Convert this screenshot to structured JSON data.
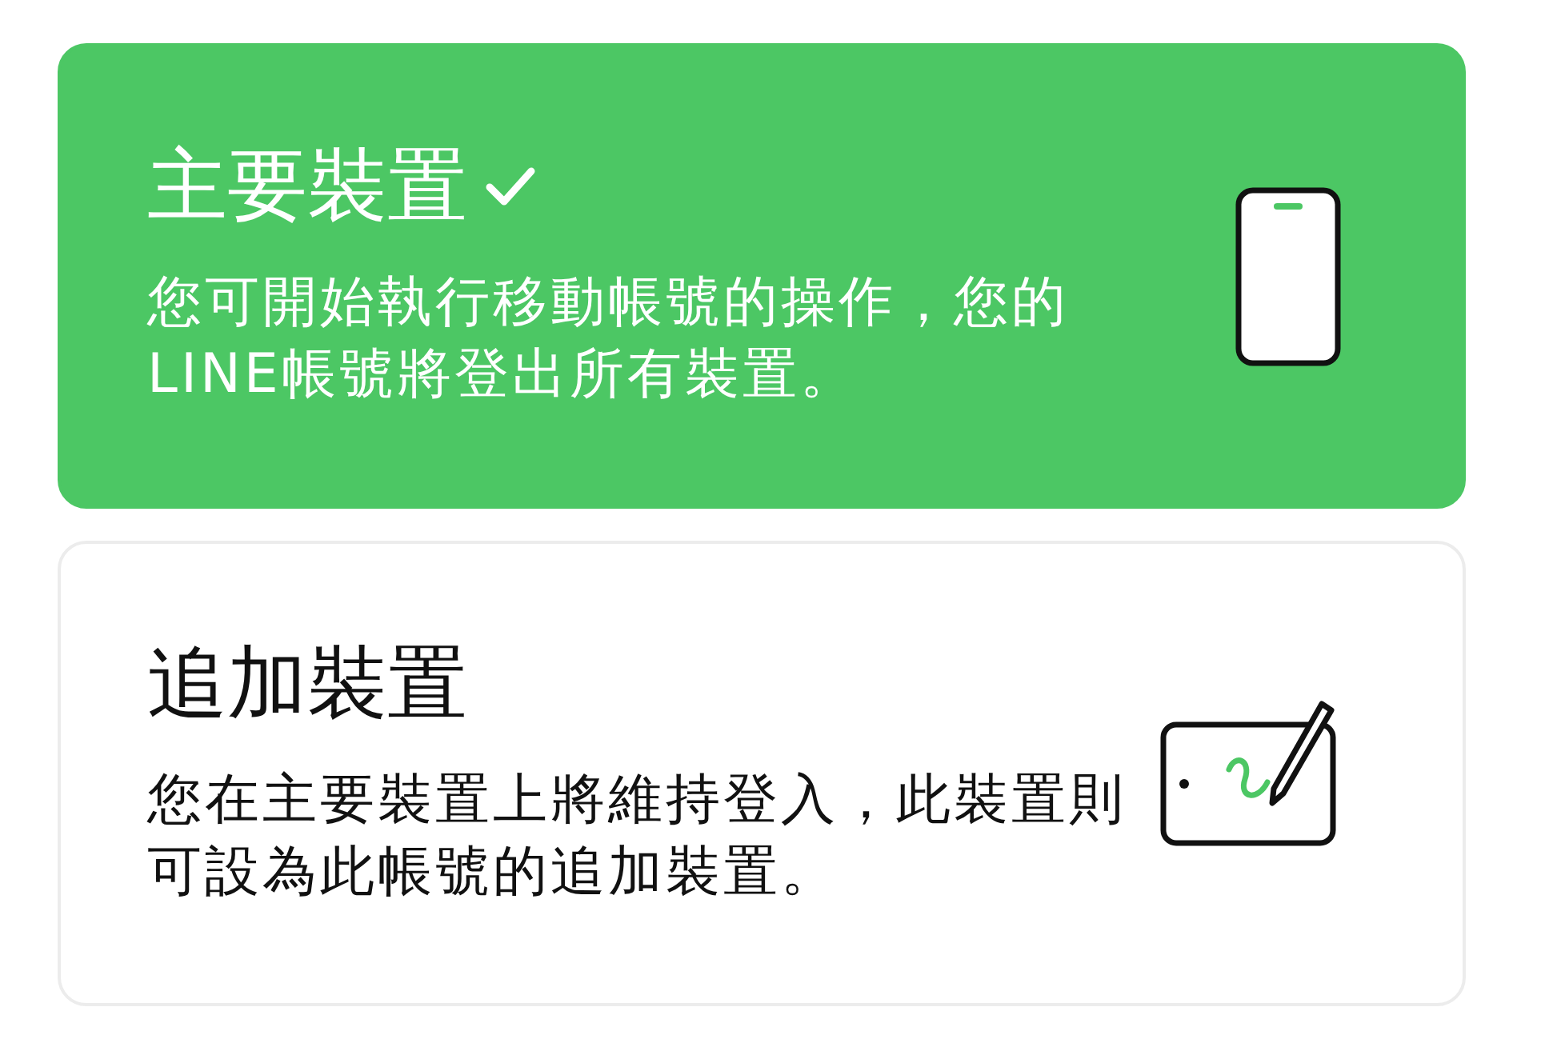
{
  "options": [
    {
      "title": "主要裝置",
      "description": "您可開始執行移動帳號的操作，您的LINE帳號將登出所有裝置。",
      "selected": true,
      "kind": "phone"
    },
    {
      "title": "追加裝置",
      "description": "您在主要裝置上將維持登入，此裝置則可設為此帳號的追加裝置。",
      "selected": false,
      "kind": "tablet"
    }
  ]
}
